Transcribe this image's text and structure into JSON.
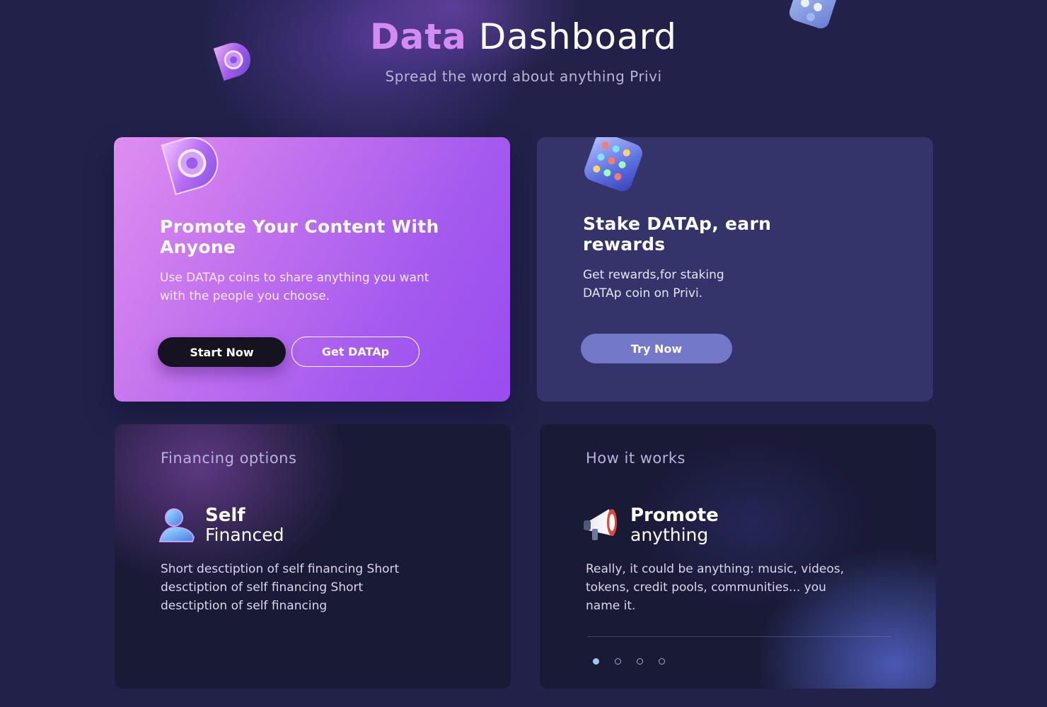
{
  "header": {
    "title_accent": "Data",
    "title_rest": "Dashboard",
    "subtitle": "Spread the word about anything Privi"
  },
  "cards": {
    "promote": {
      "heading": "Promote Your Content With Anyone",
      "description": "Use DATAp coins to share anything you want with the people you choose.",
      "primary_button": "Start Now",
      "secondary_button": "Get DATAp"
    },
    "stake": {
      "heading": "Stake DATAp, earn rewards",
      "description": "Get rewards,for staking DATAp coin on Privi.",
      "button": "Try Now"
    },
    "financing": {
      "label": "Financing options",
      "feature_title": "Self",
      "feature_subtitle": "Financed",
      "description": "Short desctiption of self financing Short desctiption of self financing Short desctiption of self financing"
    },
    "how_it_works": {
      "label": "How it works",
      "feature_title": "Promote",
      "feature_subtitle": "anything",
      "description": "Really, it could be anything: music, videos, tokens, credit pools, communities... you name it.",
      "carousel_pages": 4,
      "carousel_active_index": 0
    }
  },
  "icons": {
    "floating_logo": "datap-logo-icon",
    "floating_cube": "cube-icon",
    "promote_logo": "datap-logo-icon",
    "stake_cube": "token-cube-icon",
    "self_financed": "user-icon",
    "promote_anything": "megaphone-icon"
  },
  "colors": {
    "background": "#21214a",
    "accent_purple": "#d48cf5",
    "promote_card": "#a45aee",
    "stake_card": "#34336a",
    "try_button": "#7478c9",
    "dark_button": "#151320"
  }
}
